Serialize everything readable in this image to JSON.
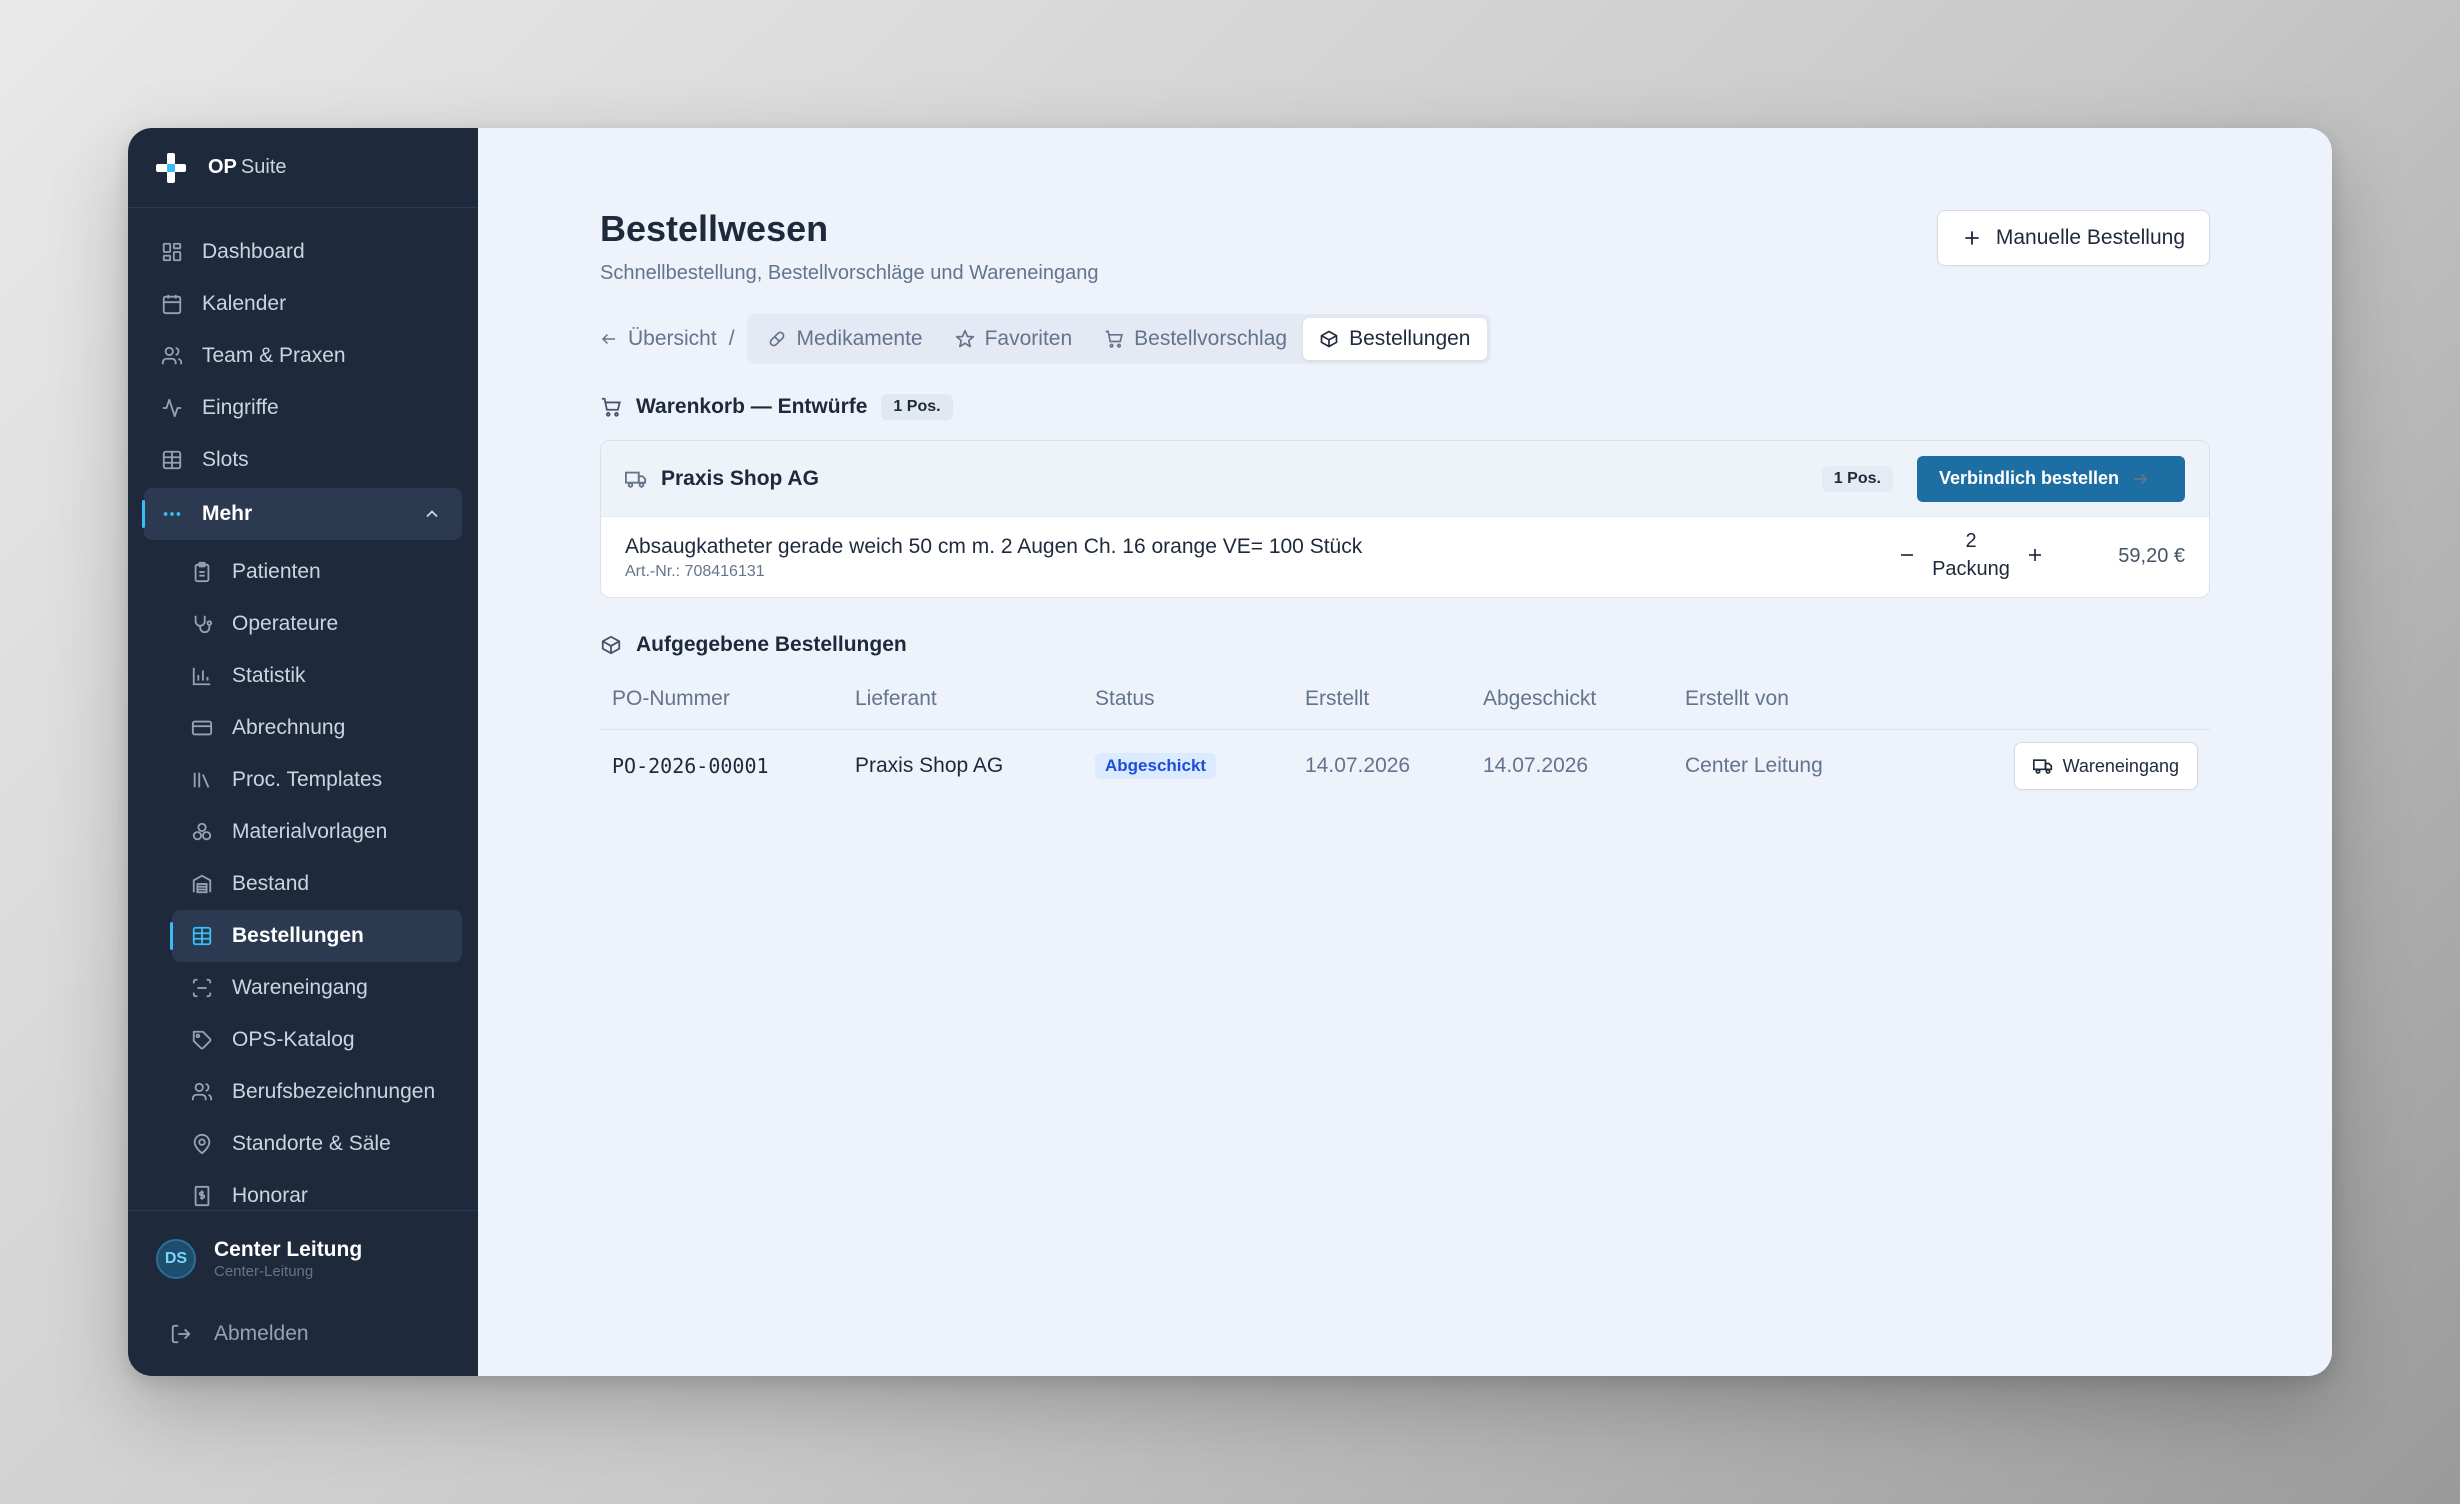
{
  "brand": {
    "name_bold": "OP",
    "name_rest": "Suite"
  },
  "nav": {
    "items": [
      {
        "label": "Dashboard",
        "icon": "dashboard-icon"
      },
      {
        "label": "Kalender",
        "icon": "calendar-icon"
      },
      {
        "label": "Team & Praxen",
        "icon": "users-icon"
      },
      {
        "label": "Eingriffe",
        "icon": "activity-icon"
      },
      {
        "label": "Slots",
        "icon": "table-icon"
      }
    ],
    "more": {
      "label": "Mehr",
      "icon": "more-icon",
      "expanded": true
    },
    "sub_items": [
      {
        "label": "Patienten",
        "icon": "clipboard-icon"
      },
      {
        "label": "Operateure",
        "icon": "stethoscope-icon"
      },
      {
        "label": "Statistik",
        "icon": "bar-chart-icon"
      },
      {
        "label": "Abrechnung",
        "icon": "credit-card-icon"
      },
      {
        "label": "Proc. Templates",
        "icon": "library-icon"
      },
      {
        "label": "Materialvorlagen",
        "icon": "boxes-icon"
      },
      {
        "label": "Bestand",
        "icon": "warehouse-icon"
      },
      {
        "label": "Bestellungen",
        "icon": "table-icon",
        "active": true
      },
      {
        "label": "Wareneingang",
        "icon": "scan-icon"
      },
      {
        "label": "OPS-Katalog",
        "icon": "tag-icon"
      },
      {
        "label": "Berufsbezeichnungen",
        "icon": "users-icon"
      },
      {
        "label": "Standorte & Säle",
        "icon": "map-pin-icon"
      },
      {
        "label": "Honorar",
        "icon": "receipt-icon"
      }
    ]
  },
  "user": {
    "initials": "DS",
    "name": "Center Leitung",
    "role": "Center-Leitung",
    "logout": "Abmelden"
  },
  "page": {
    "title": "Bestellwesen",
    "subtitle": "Schnellbestellung, Bestellvorschläge und Wareneingang",
    "manual_order_label": "Manuelle Bestellung"
  },
  "breadcrumb": {
    "back_label": "Übersicht",
    "separator": "/"
  },
  "tabs": [
    {
      "label": "Medikamente",
      "icon": "pill-icon"
    },
    {
      "label": "Favoriten",
      "icon": "star-icon"
    },
    {
      "label": "Bestellvorschlag",
      "icon": "cart-icon"
    },
    {
      "label": "Bestellungen",
      "icon": "package-icon",
      "active": true
    }
  ],
  "cart": {
    "title": "Warenkorb — Entwürfe",
    "count_badge": "1 Pos.",
    "group": {
      "supplier": "Praxis Shop AG",
      "count_badge": "1 Pos.",
      "order_button": "Verbindlich bestellen",
      "line": {
        "name": "Absaugkatheter gerade weich 50 cm m. 2 Augen Ch. 16 orange VE= 100 Stück",
        "article": "Art.-Nr.: 708416131",
        "qty": "2",
        "unit": "Packung",
        "price": "59,20 €"
      }
    }
  },
  "orders": {
    "title": "Aufgegebene Bestellungen",
    "columns": [
      "PO-Nummer",
      "Lieferant",
      "Status",
      "Erstellt",
      "Abgeschickt",
      "Erstellt von"
    ],
    "rows": [
      {
        "po": "PO-2026-00001",
        "supplier": "Praxis Shop AG",
        "status": "Abgeschickt",
        "created": "14.07.2026",
        "sent": "14.07.2026",
        "created_by": "Center Leitung",
        "action": "Wareneingang"
      }
    ]
  },
  "colors": {
    "sidebar_bg": "#1e293b",
    "accent": "#38bdf8",
    "primary_button": "#1d6fa3",
    "main_bg": "#eef2fb",
    "status_badge_bg": "#dbeafe",
    "status_badge_text": "#1d4ed8"
  }
}
